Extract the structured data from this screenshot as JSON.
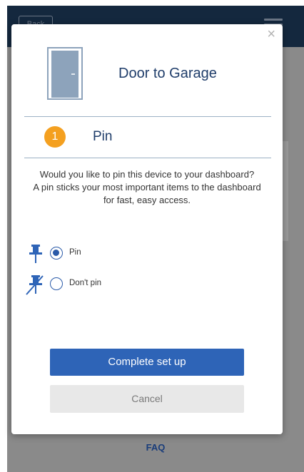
{
  "background": {
    "back_label": "Back",
    "faq_label": "FAQ"
  },
  "modal": {
    "close_symbol": "×",
    "device_icon": "door-icon",
    "device_name": "Door to Garage",
    "step": {
      "number": "1",
      "title": "Pin"
    },
    "description_line1": "Would you like to pin this device to your dashboard?",
    "description_line2": "A pin sticks your most important items to the dashboard for fast, easy access.",
    "options": [
      {
        "label": "Pin",
        "icon": "pin-icon",
        "selected": true
      },
      {
        "label": "Don't pin",
        "icon": "unpin-icon",
        "selected": false
      }
    ],
    "primary_button": "Complete set up",
    "secondary_button": "Cancel"
  },
  "colors": {
    "accent_blue": "#2e64b7",
    "title_navy": "#1f3d6a",
    "step_orange": "#f4a020",
    "header_navy": "#14283e"
  }
}
